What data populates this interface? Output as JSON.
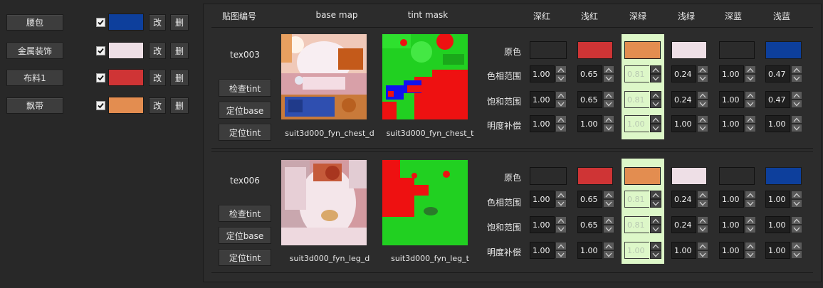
{
  "left_list": {
    "items": [
      {
        "name": "腰包",
        "checked": true,
        "color": "#0d3f9c"
      },
      {
        "name": "金属装饰",
        "checked": true,
        "color": "#eedfe6"
      },
      {
        "name": "布料1",
        "checked": true,
        "color": "#cf3435"
      },
      {
        "name": "飘带",
        "checked": true,
        "color": "#e38d50"
      }
    ],
    "edit_label": "改",
    "delete_label": "删"
  },
  "header": {
    "tex_id": "贴图编号",
    "base_map": "base map",
    "tint_mask": "tint mask",
    "columns": [
      "深红",
      "浅红",
      "深绿",
      "浅绿",
      "深蓝",
      "浅蓝"
    ]
  },
  "row_labels": {
    "original": "原色",
    "hue": "色相范围",
    "sat": "饱和范围",
    "bright": "明度补偿"
  },
  "buttons": {
    "check_tint": "检查tint",
    "locate_base": "定位base",
    "locate_tint": "定位tint"
  },
  "colors": {
    "dark_red": "#2b2b2b",
    "light_red": "#cf3435",
    "dark_green": "#e38d50",
    "light_green": "#eedfe6",
    "dark_blue": "#2b2b2b",
    "light_blue": "#0d3f9c",
    "highlight_column": "#ddf7c8"
  },
  "textures": [
    {
      "id": "tex003",
      "base_name": "suit3d000_fyn_chest_d",
      "tint_name": "suit3d000_fyn_chest_t",
      "hue": [
        "1.00",
        "0.65",
        "0.81",
        "0.24",
        "1.00",
        "0.47"
      ],
      "sat": [
        "1.00",
        "0.65",
        "0.81",
        "0.24",
        "1.00",
        "0.47"
      ],
      "bright": [
        "1.00",
        "1.00",
        "1.00",
        "1.00",
        "1.00",
        "1.00"
      ]
    },
    {
      "id": "tex006",
      "base_name": "suit3d000_fyn_leg_d",
      "tint_name": "suit3d000_fyn_leg_t",
      "hue": [
        "1.00",
        "0.65",
        "0.81",
        "0.24",
        "1.00",
        "1.00"
      ],
      "sat": [
        "1.00",
        "0.65",
        "0.81",
        "0.24",
        "1.00",
        "1.00"
      ],
      "bright": [
        "1.00",
        "1.00",
        "1.00",
        "1.00",
        "1.00",
        "1.00"
      ]
    }
  ]
}
